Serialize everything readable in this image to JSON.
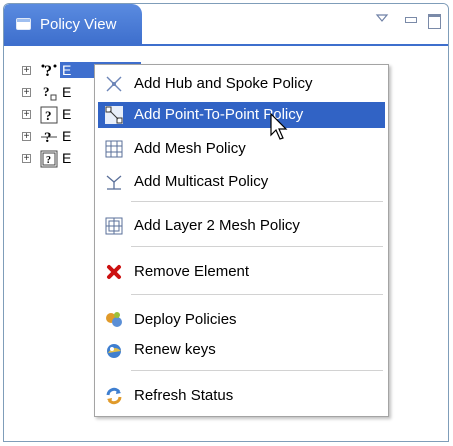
{
  "view": {
    "title": "Policy View",
    "controls": [
      "view-menu-icon",
      "minimize-icon",
      "maximize-icon"
    ]
  },
  "tree": {
    "items": [
      {
        "label": "E",
        "icon": "hub-and-spoke-node-icon",
        "selected": true
      },
      {
        "label": "E",
        "icon": "point-to-point-node-icon"
      },
      {
        "label": "E",
        "icon": "mesh-node-icon"
      },
      {
        "label": "E",
        "icon": "multicast-node-icon"
      },
      {
        "label": "E",
        "icon": "layer2-mesh-node-icon"
      }
    ]
  },
  "context_menu": {
    "items": [
      {
        "label": "Add Hub and Spoke Policy",
        "icon": "hub-and-spoke-icon"
      },
      {
        "label": "Add Point-To-Point Policy",
        "icon": "point-to-point-icon",
        "highlighted": true
      },
      {
        "label": "Add Mesh Policy",
        "icon": "mesh-icon"
      },
      {
        "label": "Add Multicast Policy",
        "icon": "multicast-icon"
      },
      {
        "label": "Add Layer 2 Mesh Policy",
        "icon": "layer2-mesh-icon"
      },
      {
        "label": "Remove Element",
        "icon": "remove-icon"
      },
      {
        "label": "Deploy Policies",
        "icon": "deploy-icon"
      },
      {
        "label": "Renew keys",
        "icon": "renew-keys-icon"
      },
      {
        "label": "Refresh Status",
        "icon": "refresh-icon"
      }
    ]
  },
  "colors": {
    "tab_blue": "#3e6fcd",
    "highlight": "#3163c5",
    "remove_red": "#cc1111"
  }
}
